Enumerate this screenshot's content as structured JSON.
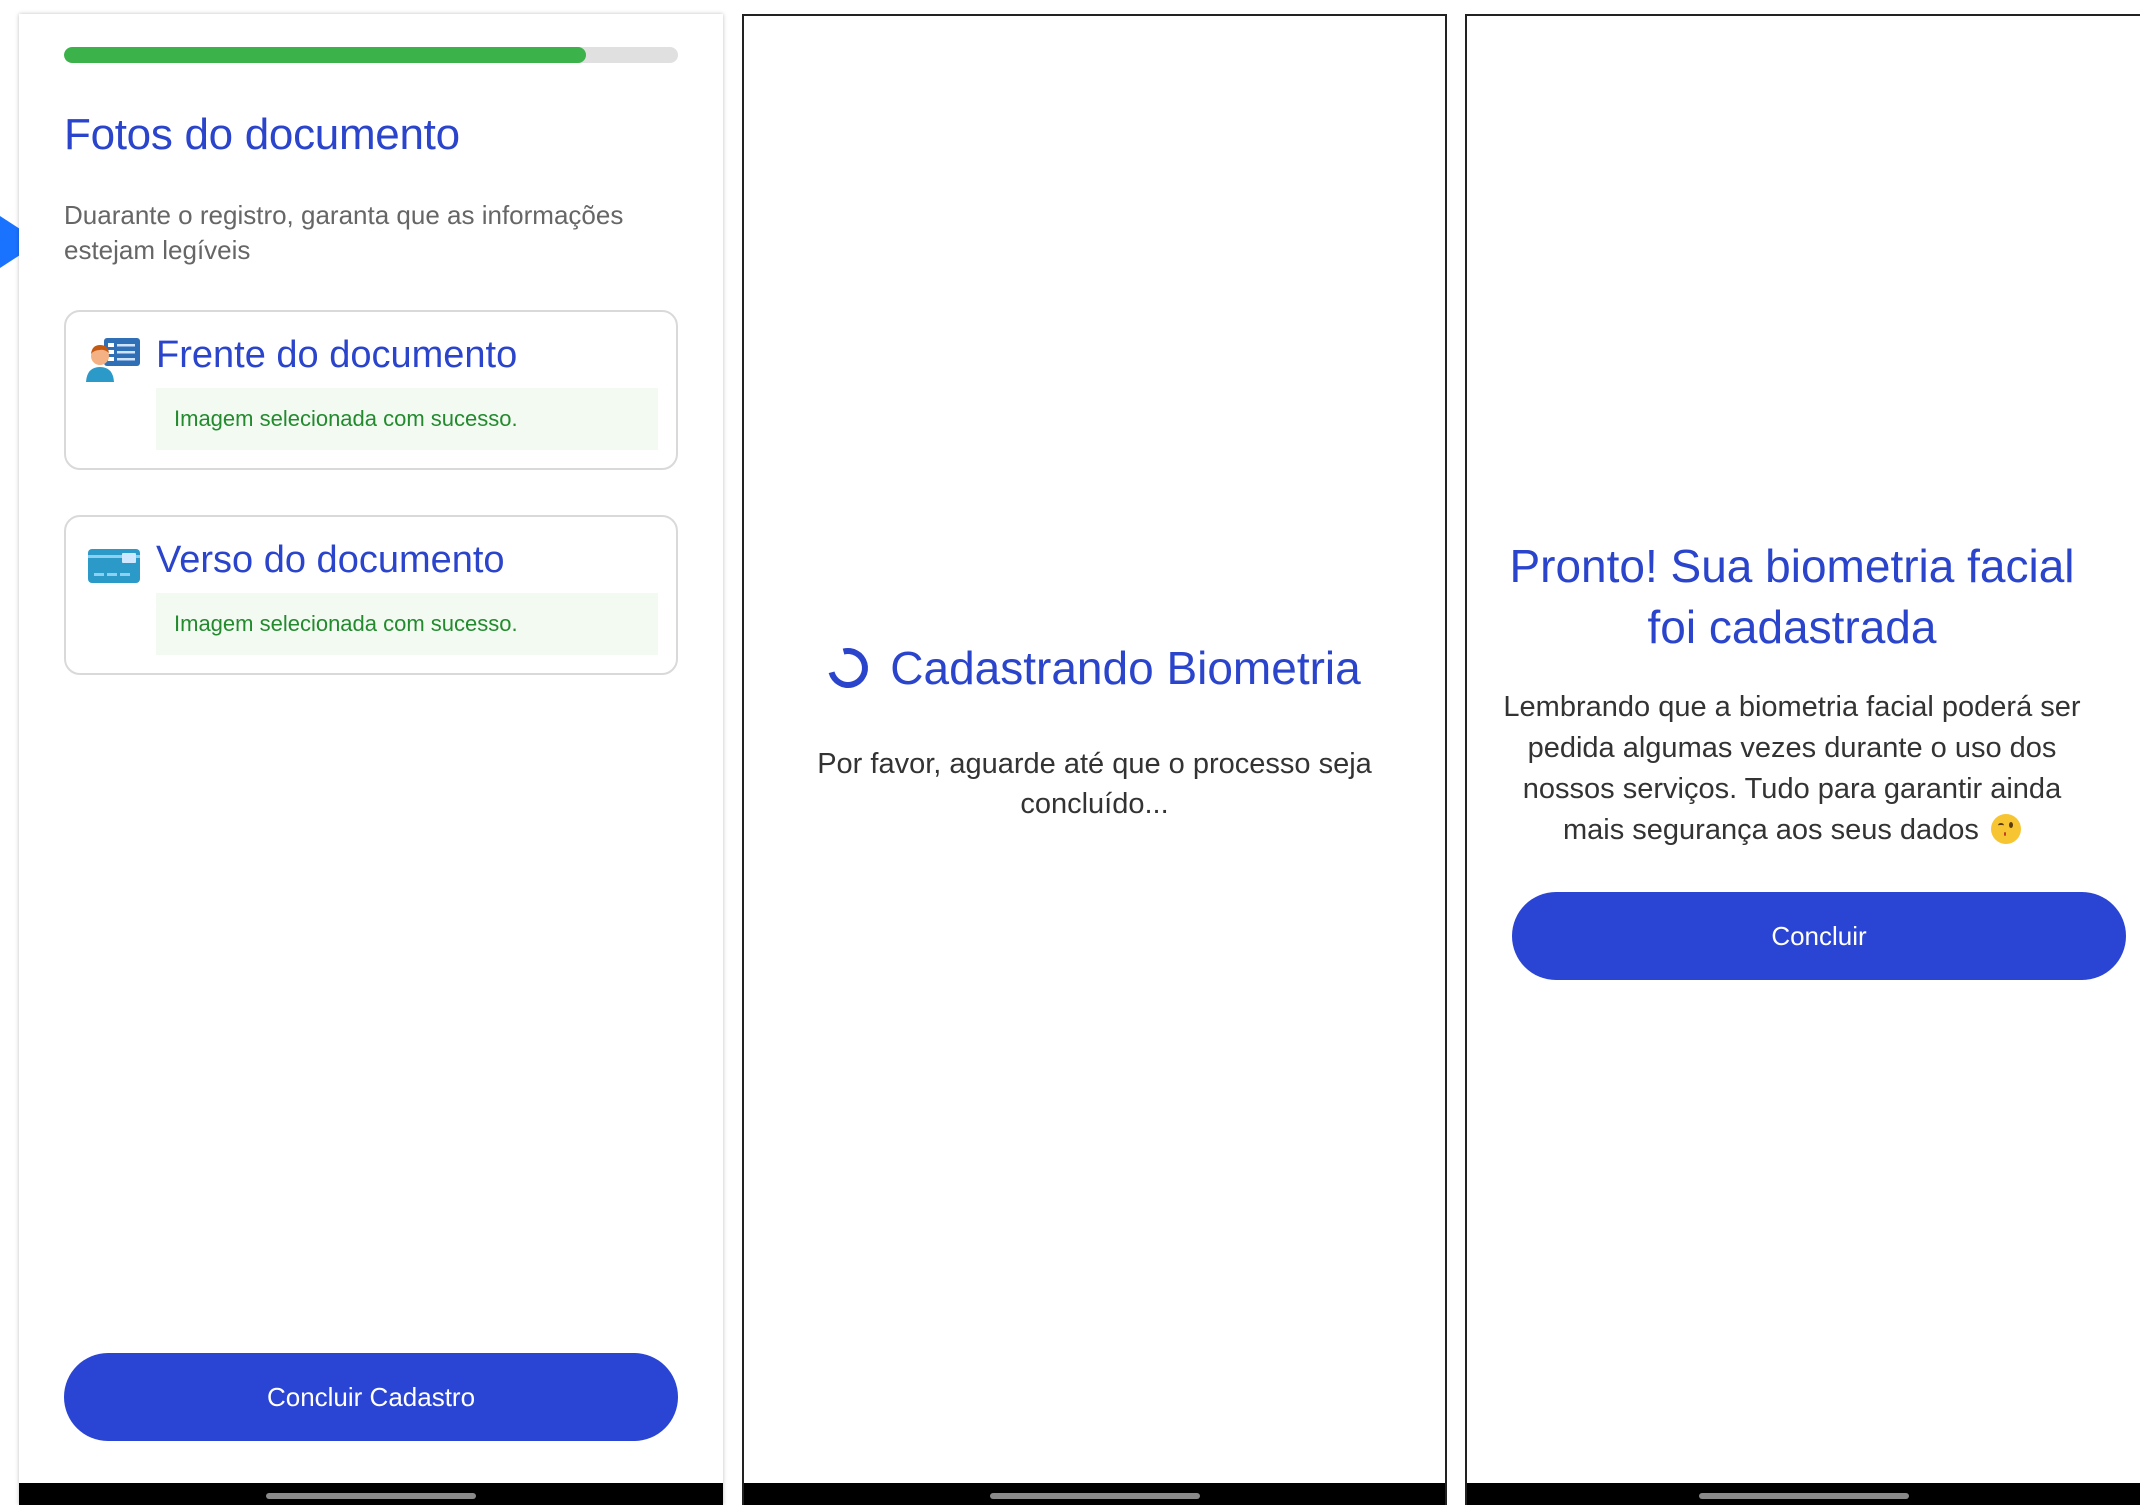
{
  "colors": {
    "accent_blue": "#2a44cc",
    "button_blue": "#2a44d4",
    "progress_green": "#3cb34a",
    "success_text": "#238a2e"
  },
  "screen1": {
    "progress_fraction": 0.85,
    "title": "Fotos do documento",
    "subtitle": "Duarante o registro, garanta que as informações estejam legíveis",
    "cards": [
      {
        "icon": "id-card-person-icon",
        "title": "Frente do documento",
        "status": "Imagem selecionada com sucesso."
      },
      {
        "icon": "card-back-icon",
        "title": "Verso do documento",
        "status": "Imagem selecionada com sucesso."
      }
    ],
    "button_label": "Concluir Cadastro"
  },
  "screen2": {
    "title": "Cadastrando Biometria",
    "text": "Por favor, aguarde até que o processo seja concluído..."
  },
  "screen3": {
    "title": "Pronto! Sua biometria facial foi cadastrada",
    "text": "Lembrando que a biometria facial poderá ser pedida algumas vezes durante o uso dos nossos serviços. Tudo para garantir ainda mais segurança aos seus dados",
    "emoji": "winking-face-icon",
    "button_label": "Concluir"
  }
}
